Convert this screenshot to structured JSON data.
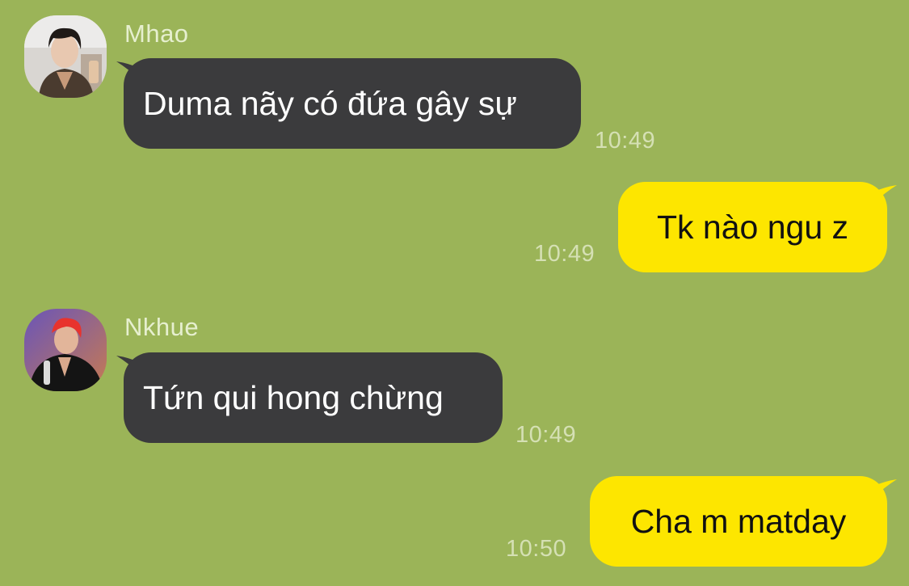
{
  "colors": {
    "background": "#9bb458",
    "incoming_bubble": "#3b3b3d",
    "outgoing_bubble": "#fde600",
    "sender_name": "#e6efcf",
    "timestamp": "#d5e0b4"
  },
  "messages": [
    {
      "direction": "incoming",
      "sender": "Mhao",
      "avatar_icon": "profile-photo-icon",
      "text": "Duma nãy có đứa gây sự",
      "time": "10:49"
    },
    {
      "direction": "outgoing",
      "text": "Tk nào ngu z",
      "time": "10:49"
    },
    {
      "direction": "incoming",
      "sender": "Nkhue",
      "avatar_icon": "profile-photo-icon",
      "text": "Tứn qui hong chừng",
      "time": "10:49"
    },
    {
      "direction": "outgoing",
      "text": "Cha m matday",
      "time": "10:50"
    }
  ]
}
